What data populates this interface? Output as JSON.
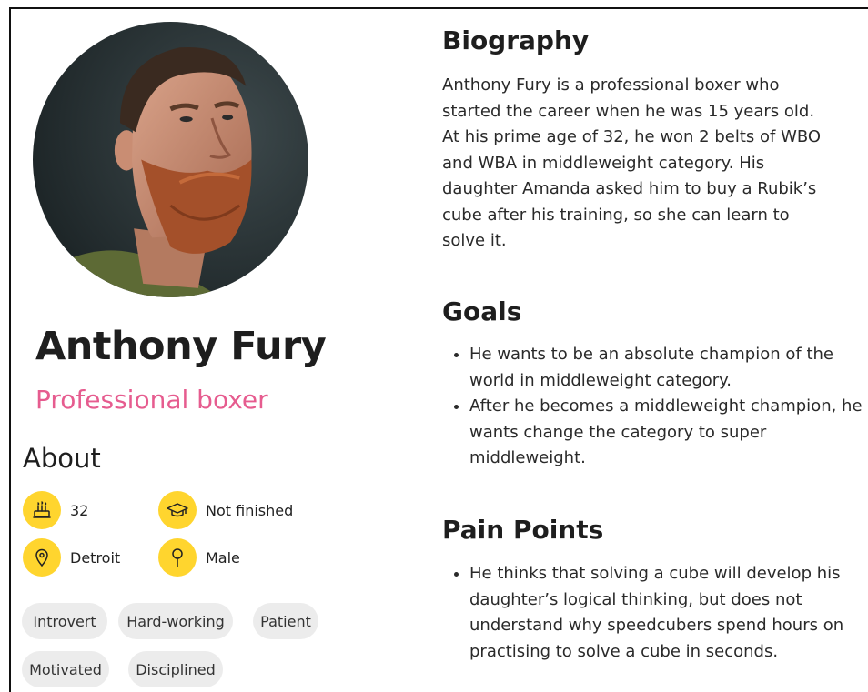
{
  "profile": {
    "name": "Anthony Fury",
    "role": "Professional boxer"
  },
  "about": {
    "title": "About",
    "facts": [
      {
        "icon": "birthday-cake-icon",
        "value": "32"
      },
      {
        "icon": "graduation-cap-icon",
        "value": "Not finished"
      },
      {
        "icon": "location-pin-icon",
        "value": "Detroit"
      },
      {
        "icon": "gender-icon",
        "value": "Male"
      }
    ],
    "tags": [
      "Introvert",
      "Hard-working",
      "Patient",
      "Motivated",
      "Disciplined"
    ]
  },
  "biography": {
    "title": "Biography",
    "text": "Anthony Fury is a professional boxer who started the career when he was 15 years old. At his prime age of 32, he won 2 belts of WBO and WBA in middleweight category. His daughter Amanda asked him to buy a Rubik’s cube after his training, so she can learn to solve it."
  },
  "goals": {
    "title": "Goals",
    "items": [
      "He wants to be an absolute champion of the world in middleweight category.",
      "After he becomes a middleweight champion, he wants change the category to super middleweight."
    ]
  },
  "pain_points": {
    "title": "Pain Points",
    "items": [
      "He thinks that solving a cube will develop his daughter’s logical thinking, but does not understand why speedcubers spend hours on practising to solve a cube in seconds."
    ]
  },
  "colors": {
    "accent": "#e65c8f",
    "icon_background": "#ffd52e",
    "tag_background": "#ececec"
  }
}
